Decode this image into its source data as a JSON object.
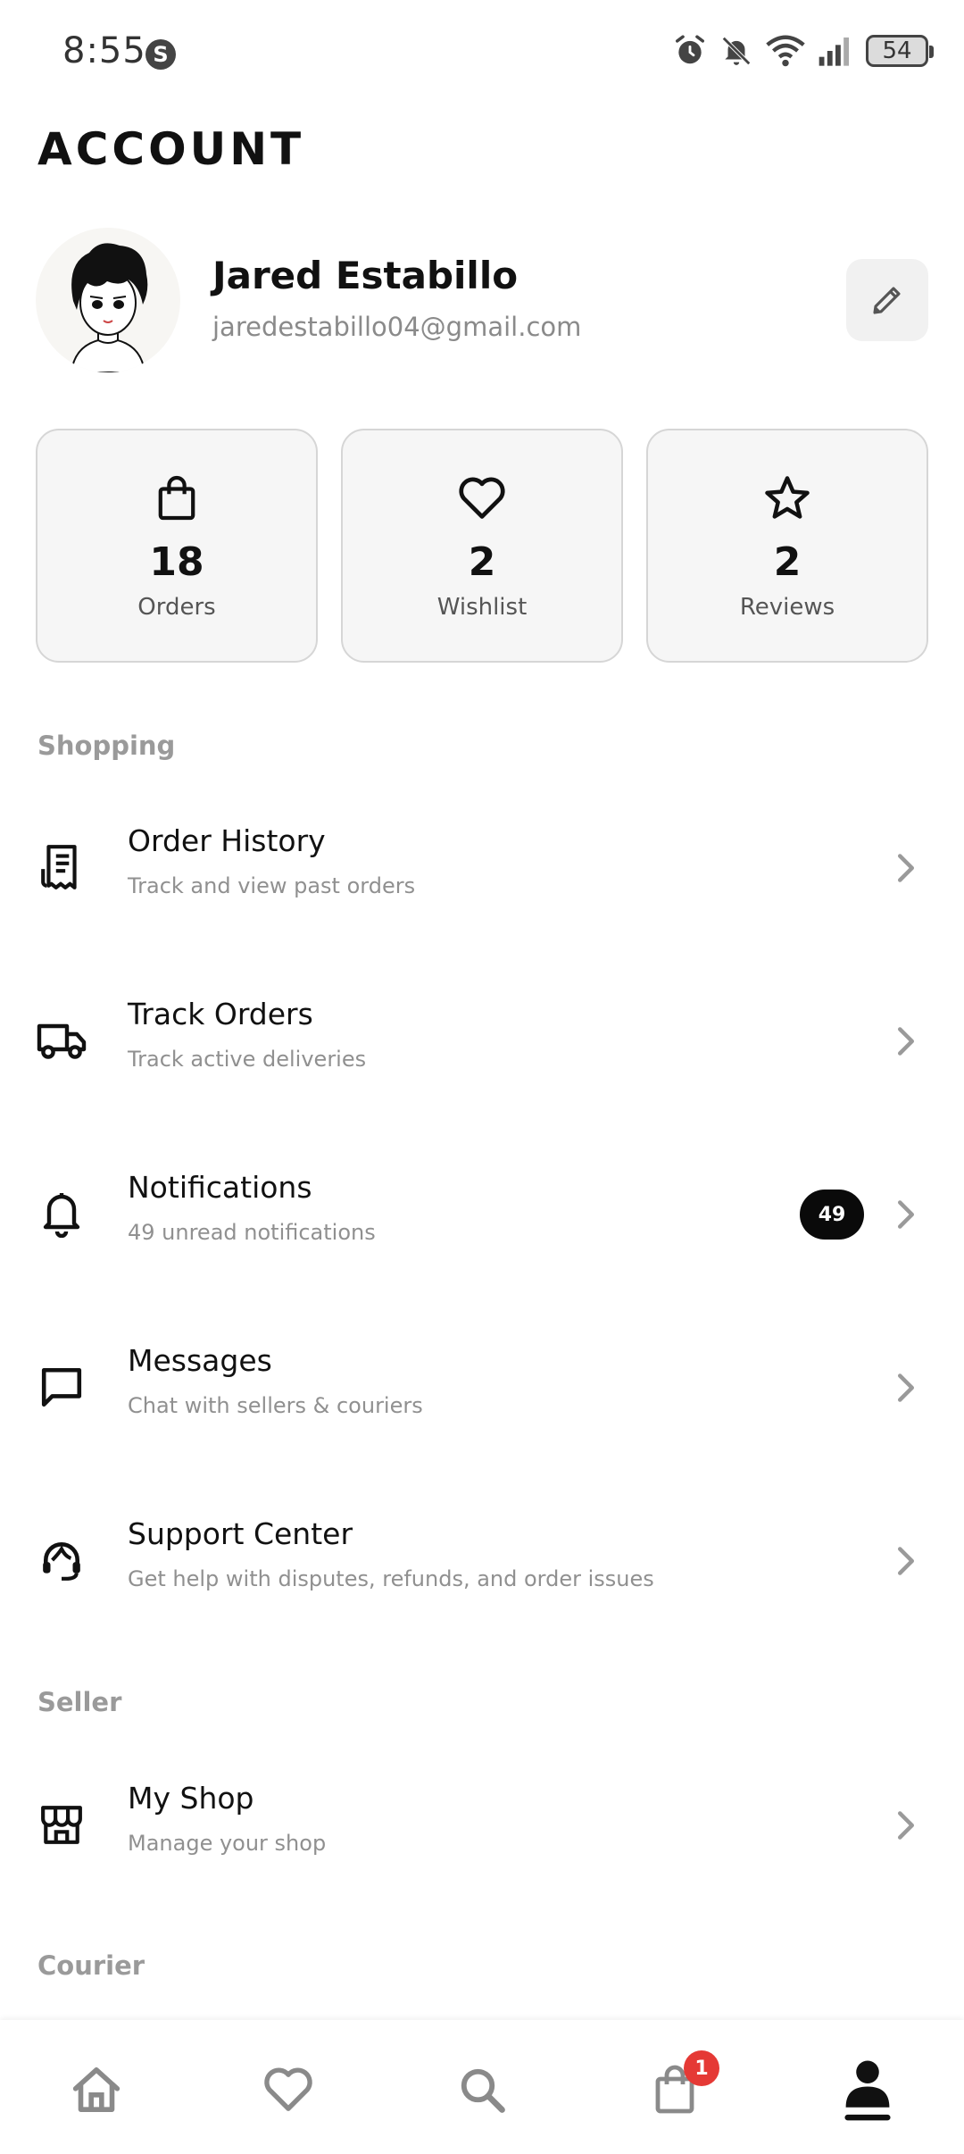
{
  "status_bar": {
    "time": "8:55",
    "app_badge": "S",
    "battery": "54"
  },
  "header": {
    "title": "ACCOUNT"
  },
  "profile": {
    "name": "Jared Estabillo",
    "email": "jaredestabillo04@gmail.com"
  },
  "stats": [
    {
      "icon": "shopping-bag-icon",
      "value": "18",
      "label": "Orders"
    },
    {
      "icon": "heart-icon",
      "value": "2",
      "label": "Wishlist"
    },
    {
      "icon": "star-icon",
      "value": "2",
      "label": "Reviews"
    }
  ],
  "sections": {
    "shopping": "Shopping",
    "seller": "Seller",
    "courier": "Courier"
  },
  "menu": {
    "order_history": {
      "title": "Order History",
      "subtitle": "Track and view past orders",
      "icon": "receipt-icon"
    },
    "track_orders": {
      "title": "Track Orders",
      "subtitle": "Track active deliveries",
      "icon": "truck-icon"
    },
    "notifications": {
      "title": "Notifications",
      "subtitle": "49 unread notifications",
      "badge": "49",
      "icon": "bell-icon"
    },
    "messages": {
      "title": "Messages",
      "subtitle": "Chat with sellers & couriers",
      "icon": "chat-icon"
    },
    "support": {
      "title": "Support Center",
      "subtitle": "Get help with disputes, refunds, and order issues",
      "icon": "headset-icon"
    },
    "my_shop": {
      "title": "My Shop",
      "subtitle": "Manage your shop",
      "icon": "store-icon"
    }
  },
  "bottom_nav": {
    "items": [
      "home-icon",
      "heart-icon",
      "search-icon",
      "cart-icon",
      "profile-icon"
    ],
    "active": "profile-icon",
    "cart_badge": "1"
  },
  "colors": {
    "accent": "#111111",
    "muted": "#909090",
    "badge_red": "#e53935"
  }
}
